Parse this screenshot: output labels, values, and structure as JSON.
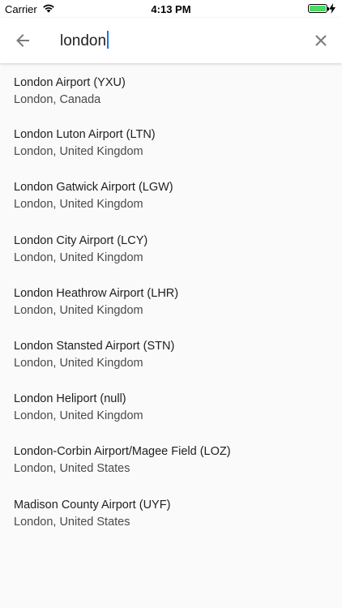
{
  "status_bar": {
    "carrier": "Carrier",
    "time": "4:13 PM",
    "battery_color": "#4cd964"
  },
  "search": {
    "query": "london",
    "back_icon": "arrow-left-icon",
    "clear_icon": "close-icon",
    "caret_color": "#1a73e8"
  },
  "results": [
    {
      "title": "London Airport (YXU)",
      "subtitle": "London, Canada"
    },
    {
      "title": "London Luton Airport (LTN)",
      "subtitle": "London, United Kingdom"
    },
    {
      "title": "London Gatwick Airport (LGW)",
      "subtitle": "London, United Kingdom"
    },
    {
      "title": "London City Airport (LCY)",
      "subtitle": "London, United Kingdom"
    },
    {
      "title": "London Heathrow Airport (LHR)",
      "subtitle": "London, United Kingdom"
    },
    {
      "title": "London Stansted Airport (STN)",
      "subtitle": "London, United Kingdom"
    },
    {
      "title": "London Heliport (null)",
      "subtitle": "London, United Kingdom"
    },
    {
      "title": "London-Corbin Airport/Magee Field (LOZ)",
      "subtitle": "London, United States"
    },
    {
      "title": "Madison County Airport (UYF)",
      "subtitle": "London, United States"
    }
  ]
}
